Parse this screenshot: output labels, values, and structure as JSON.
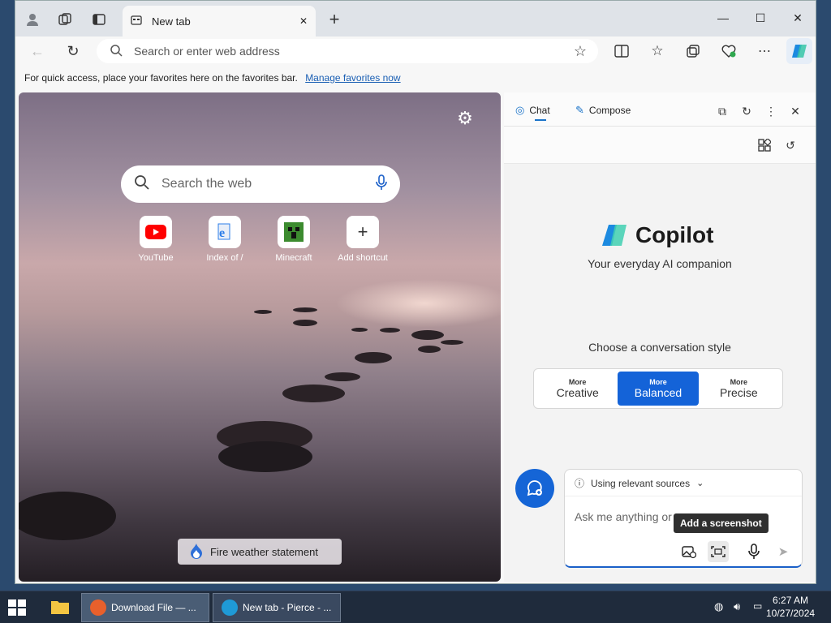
{
  "browser": {
    "tab": {
      "title": "New tab",
      "close": "✕"
    },
    "new_tab": "+",
    "window_controls": {
      "minimize": "—",
      "maximize": "☐",
      "close": "✕"
    },
    "address": {
      "placeholder": "Search or enter web address"
    },
    "favorites_bar": {
      "text": "For quick access, place your favorites here on the favorites bar.",
      "link": "Manage favorites now"
    }
  },
  "new_tab_page": {
    "search": {
      "placeholder": "Search the web"
    },
    "shortcuts": [
      {
        "label": "YouTube",
        "color": "#ff0000"
      },
      {
        "label": "Index of /",
        "color": "#2b7de9"
      },
      {
        "label": "Minecraft",
        "color": "#3c8b2f"
      },
      {
        "label": "Add shortcut",
        "glyph": "+"
      }
    ],
    "weather_button": "Fire weather statement"
  },
  "copilot": {
    "tabs": {
      "chat": "Chat",
      "compose": "Compose"
    },
    "title": "Copilot",
    "subtitle": "Your everyday AI companion",
    "choose_style": "Choose a conversation style",
    "styles": [
      {
        "more": "More",
        "name": "Creative",
        "active": false
      },
      {
        "more": "More",
        "name": "Balanced",
        "active": true
      },
      {
        "more": "More",
        "name": "Precise",
        "active": false
      }
    ],
    "sources": "Using relevant sources",
    "ask_placeholder": "Ask me anything or",
    "tooltip": "Add a screenshot"
  },
  "taskbar": {
    "buttons": [
      {
        "label": "Download File — ...",
        "icon_color": "#e8602c"
      },
      {
        "label": "New tab - Pierce - ...",
        "icon_color": "#1f9ad6"
      }
    ],
    "time": "6:27 AM",
    "date": "10/27/2024"
  },
  "colors": {
    "accent": "#1463d8",
    "link": "#1a5fb4"
  }
}
